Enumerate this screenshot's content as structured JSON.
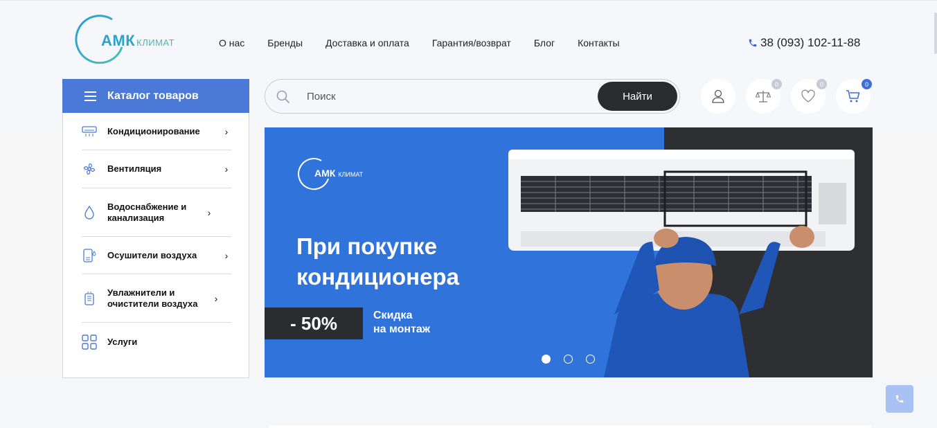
{
  "header": {
    "logo_main": "АМК",
    "logo_sub": "КЛИМАТ",
    "nav": [
      "О нас",
      "Бренды",
      "Доставка и оплата",
      "Гарантия/возврат",
      "Блог",
      "Контакты"
    ],
    "phone": "38 (093) 102-11-88"
  },
  "catalog": {
    "title": "Каталог товаров",
    "items": [
      {
        "label": "Кондиционирование",
        "icon": "air-conditioner-icon"
      },
      {
        "label": "Вентиляция",
        "icon": "fan-icon"
      },
      {
        "label": "Водоснабжение и канализация",
        "icon": "water-drop-icon"
      },
      {
        "label": "Осушители воздуха",
        "icon": "dehumidifier-icon"
      },
      {
        "label": "Увлажнители и очистители воздуха",
        "icon": "humidifier-icon"
      },
      {
        "label": "Услуги",
        "icon": "grid-icon"
      }
    ]
  },
  "search": {
    "placeholder": "Поиск",
    "button": "Найти"
  },
  "user_actions": {
    "compare_count": "0",
    "favorites_count": "0",
    "cart_count": "0"
  },
  "banner": {
    "logo_main": "АМК",
    "logo_sub": "КЛИМАТ",
    "headline_line1": "При покупке",
    "headline_line2": "кондиционера",
    "discount": "- 50%",
    "discount_text_line1": "Скидка",
    "discount_text_line2": "на монтаж",
    "slides": 3,
    "active_slide": 1
  },
  "colors": {
    "accent": "#4a79d8",
    "banner_blue": "#2f73db",
    "dark": "#2a2b2e"
  }
}
